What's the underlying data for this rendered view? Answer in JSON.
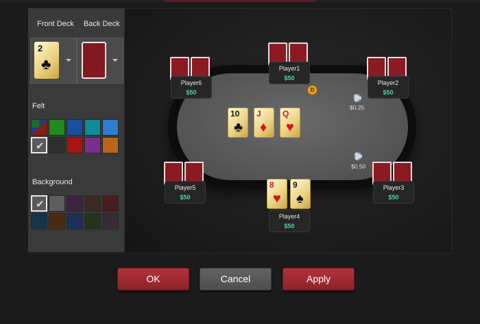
{
  "settings": {
    "front_deck_label": "Front Deck",
    "back_deck_label": "Back Deck",
    "front_deck_card": {
      "rank": "2",
      "suit": "♣"
    },
    "felt_label": "Felt",
    "background_label": "Background",
    "felt_colors": [
      "multi",
      "#1f8a1f",
      "#1a4fa0",
      "#0f8c96",
      "#2f7dd0",
      "#5a5a5a",
      "#2d2d2d",
      "#a81414",
      "#7a2f8e",
      "#b8661a"
    ],
    "felt_selected_index": 5,
    "background_colors": [
      "#5a5a5a",
      "#5e5e5e",
      "#3a2440",
      "#3a2a22",
      "#4a1c1c",
      "#14344a",
      "#4a2c14",
      "#1c2e5a",
      "#23331c",
      "#3a2a36"
    ],
    "background_selected_index": 0,
    "check_glyph": "✔"
  },
  "table": {
    "players": [
      {
        "name": "Player1",
        "stack": "$50"
      },
      {
        "name": "Player2",
        "stack": "$50"
      },
      {
        "name": "Player3",
        "stack": "$50"
      },
      {
        "name": "Player4",
        "stack": "$50"
      },
      {
        "name": "Player5",
        "stack": "$50"
      },
      {
        "name": "Player6",
        "stack": "$50"
      }
    ],
    "hero_cards": [
      {
        "rank": "8",
        "suit": "♥",
        "color": "red"
      },
      {
        "rank": "9",
        "suit": "♠",
        "color": "black"
      }
    ],
    "board": [
      {
        "rank": "10",
        "suit": "♣",
        "color": "black"
      },
      {
        "rank": "J",
        "suit": "♦",
        "color": "red"
      },
      {
        "rank": "Q",
        "suit": "♥",
        "color": "red"
      }
    ],
    "dealer_button": "D",
    "bets": [
      "$0.25",
      "$0.50"
    ]
  },
  "buttons": {
    "ok": "OK",
    "cancel": "Cancel",
    "apply": "Apply"
  }
}
